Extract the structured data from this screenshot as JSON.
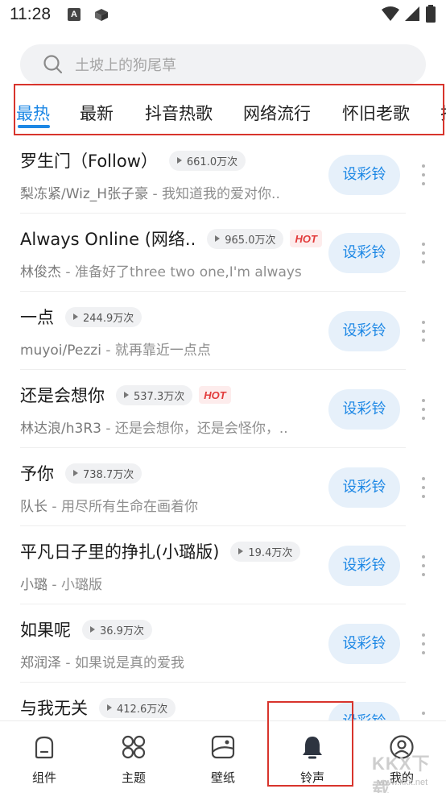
{
  "status_bar": {
    "time": "11:28"
  },
  "search": {
    "placeholder": "土坡上的狗尾草"
  },
  "tabs": [
    {
      "label": "最热",
      "active": true
    },
    {
      "label": "最新",
      "active": false
    },
    {
      "label": "抖音热歌",
      "active": false
    },
    {
      "label": "网络流行",
      "active": false
    },
    {
      "label": "怀旧老歌",
      "active": false
    }
  ],
  "set_button_label": "设彩铃",
  "hot_label": "HOT",
  "songs": [
    {
      "title": "罗生门（Follow）",
      "plays": "661.0万次",
      "hot": false,
      "artist": "梨冻紧/Wiz_H张子豪",
      "subtitle": "我知道我的爱对你.."
    },
    {
      "title": "Always Online (网络..",
      "plays": "965.0万次",
      "hot": true,
      "artist": "林俊杰",
      "subtitle": "准备好了three two one,I'm always.."
    },
    {
      "title": "一点",
      "plays": "244.9万次",
      "hot": false,
      "artist": "muyoi/Pezzi",
      "subtitle": "就再靠近一点点"
    },
    {
      "title": "还是会想你",
      "plays": "537.3万次",
      "hot": true,
      "artist": "林达浪/h3R3",
      "subtitle": "还是会想你，还是会怪你，.."
    },
    {
      "title": "予你",
      "plays": "738.7万次",
      "hot": false,
      "artist": "队长",
      "subtitle": "用尽所有生命在画着你"
    },
    {
      "title": "平凡日子里的挣扎(小璐版)",
      "plays": "19.4万次",
      "hot": false,
      "artist": "小璐",
      "subtitle": "小璐版"
    },
    {
      "title": "如果呢",
      "plays": "36.9万次",
      "hot": false,
      "artist": "郑润泽",
      "subtitle": "如果说是真的爱我"
    },
    {
      "title": "与我无关",
      "plays": "412.6万次",
      "hot": false,
      "artist": "",
      "subtitle": ""
    }
  ],
  "bottom_nav": [
    {
      "label": "组件",
      "icon": "widget-icon",
      "active": false
    },
    {
      "label": "主题",
      "icon": "theme-icon",
      "active": false
    },
    {
      "label": "壁纸",
      "icon": "wallpaper-icon",
      "active": false
    },
    {
      "label": "铃声",
      "icon": "bell-icon",
      "active": true
    },
    {
      "label": "我的",
      "icon": "profile-icon",
      "active": false
    }
  ],
  "watermark": {
    "text": "KKX下载",
    "sub": "www.kkx.net"
  },
  "colors": {
    "accent": "#1e88e5",
    "hot": "#e23a3a",
    "annotation": "#d8342c"
  }
}
